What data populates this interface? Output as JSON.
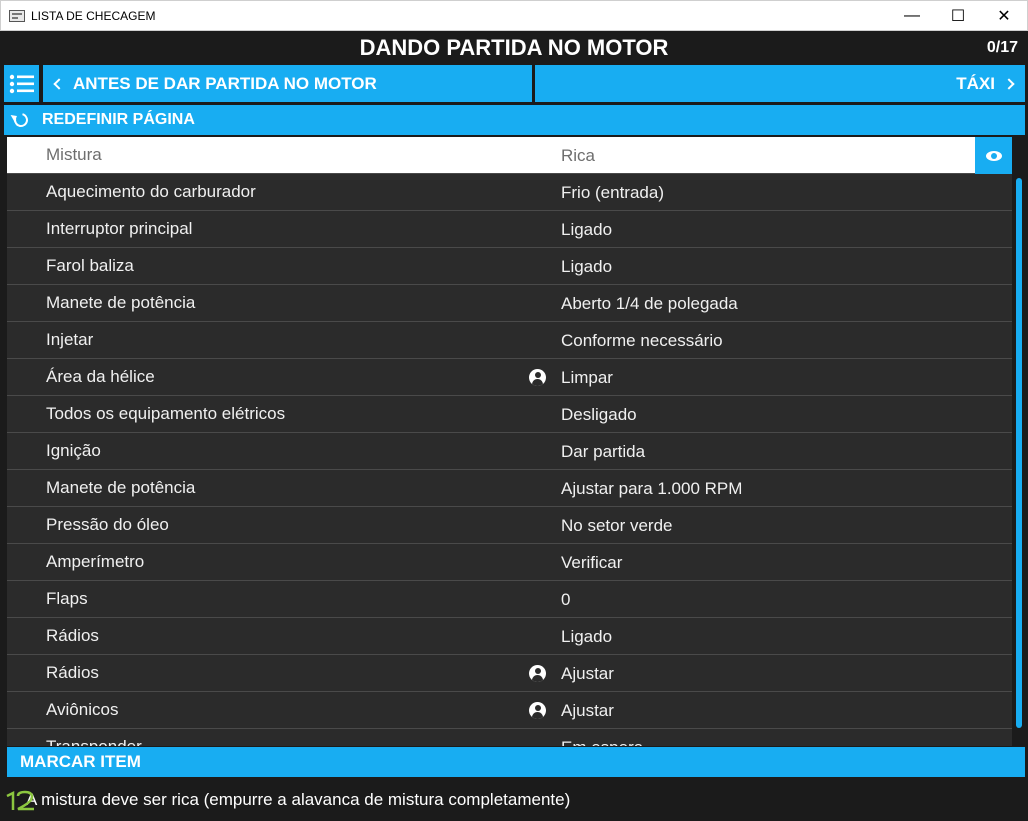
{
  "window": {
    "title": "LISTA DE CHECAGEM",
    "controls": {
      "minimize": "—",
      "maximize": "☐",
      "close": "✕"
    }
  },
  "header": {
    "title": "DANDO PARTIDA NO MOTOR",
    "counter": "0/17"
  },
  "nav": {
    "prev_label": "ANTES DE DAR PARTIDA NO MOTOR",
    "next_label": "TÁXI"
  },
  "reset": {
    "label": "REDEFINIR PÁGINA"
  },
  "items": [
    {
      "item": "Mistura",
      "value": "Rica",
      "active": true,
      "person": false
    },
    {
      "item": "Aquecimento do carburador",
      "value": "Frio (entrada)",
      "person": false
    },
    {
      "item": "Interruptor principal",
      "value": "Ligado",
      "person": false
    },
    {
      "item": "Farol baliza",
      "value": "Ligado",
      "person": false
    },
    {
      "item": "Manete de potência",
      "value": "Aberto 1/4 de polegada",
      "person": false
    },
    {
      "item": "Injetar",
      "value": "Conforme necessário",
      "person": false
    },
    {
      "item": "Área da hélice",
      "value": "Limpar",
      "person": true
    },
    {
      "item": "Todos os equipamento elétricos",
      "value": "Desligado",
      "person": false
    },
    {
      "item": "Ignição",
      "value": "Dar partida",
      "person": false
    },
    {
      "item": "Manete de potência",
      "value": "Ajustar para 1.000 RPM",
      "person": false
    },
    {
      "item": "Pressão do óleo",
      "value": "No setor verde",
      "person": false
    },
    {
      "item": "Amperímetro",
      "value": "Verificar",
      "person": false
    },
    {
      "item": "Flaps",
      "value": "0",
      "person": false
    },
    {
      "item": "Rádios",
      "value": "Ligado",
      "person": false
    },
    {
      "item": "Rádios",
      "value": "Ajustar",
      "person": true
    },
    {
      "item": "Aviônicos",
      "value": "Ajustar",
      "person": true
    },
    {
      "item": "Transponder",
      "value": "Em espera",
      "person": false
    }
  ],
  "mark": {
    "label": "MARCAR ITEM"
  },
  "note": {
    "text": "A mistura deve ser rica (empurre a alavanca de mistura completamente)"
  },
  "colors": {
    "accent": "#18adf2",
    "background": "#1b1b1b",
    "list_bg": "#2b2b2b",
    "logo": "#8cc63f"
  }
}
